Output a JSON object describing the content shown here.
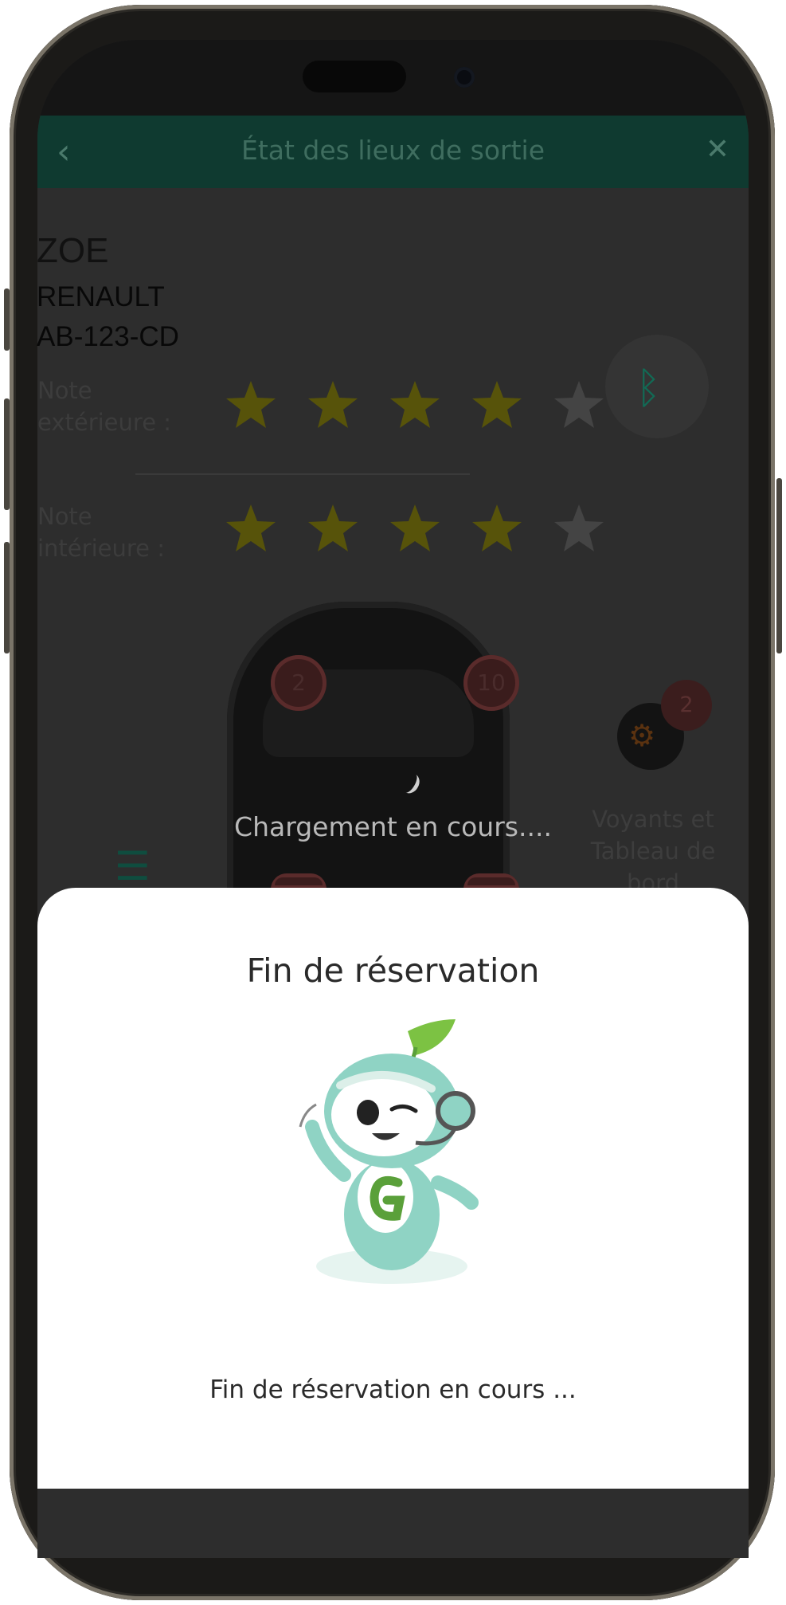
{
  "header": {
    "title": "État des lieux de sortie",
    "back_icon": "chevron-left-icon",
    "close_icon": "close-icon"
  },
  "vehicle": {
    "model": "ZOE",
    "brand": "RENAULT",
    "plate": "AB-123-CD"
  },
  "ratings": {
    "exterior": {
      "label_line1": "Note",
      "label_line2": "extérieure :",
      "value": 4,
      "max": 5
    },
    "interior": {
      "label_line1": "Note",
      "label_line2": "intérieure :",
      "value": 4,
      "max": 5
    }
  },
  "bluetooth": {
    "icon": "bluetooth-icon"
  },
  "damage_markers": [
    "2",
    "10"
  ],
  "dashboard": {
    "badge": "2",
    "label_line1": "Voyants et",
    "label_line2": "Tableau de",
    "label_line3": "bord",
    "icon": "engine-warning-icon"
  },
  "list_icon": "list-icon",
  "loading_text": "Chargement en cours....",
  "modal": {
    "title": "Fin de réservation",
    "message": "Fin de réservation en cours ...",
    "mascot": "mascot-robot-icon"
  },
  "colors": {
    "header_green": "#0f3a30",
    "star_gold": "#57530a",
    "star_empty": "#444444",
    "mascot_teal": "#8fd3c4",
    "leaf_green": "#7cc243"
  }
}
